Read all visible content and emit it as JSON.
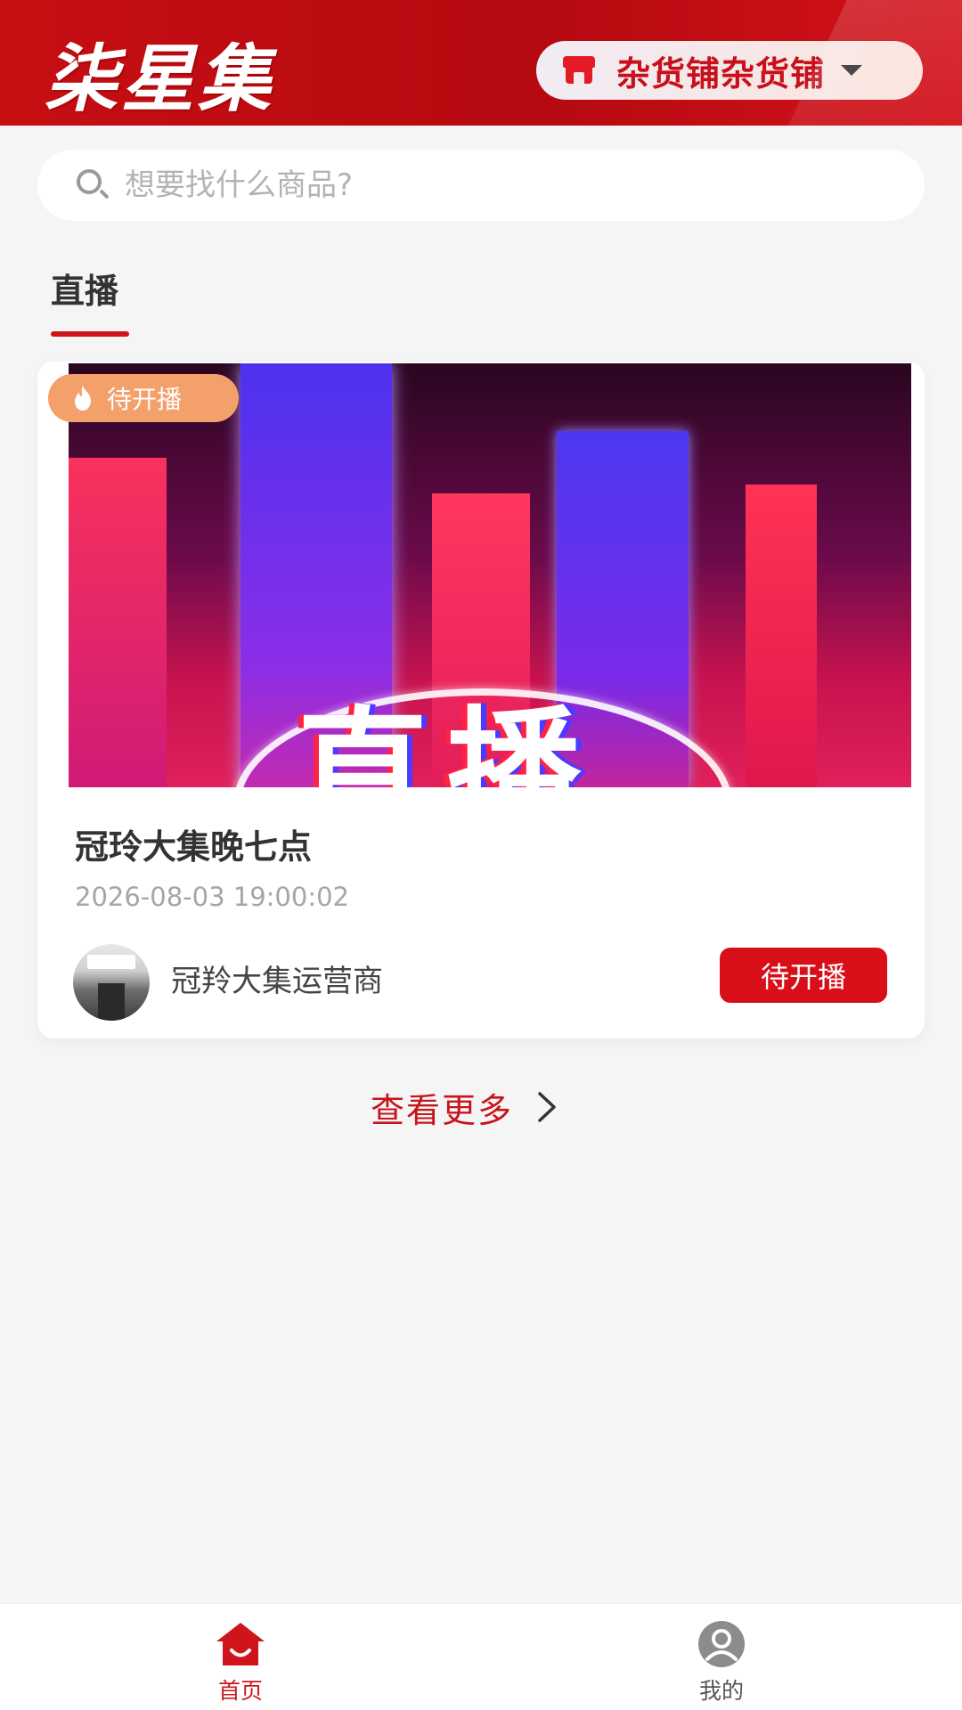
{
  "header": {
    "logo_text": "柒星集",
    "store_selector": {
      "label": "杂货铺杂货铺",
      "icon": "store-icon",
      "dropdown_icon": "caret-down-icon"
    }
  },
  "search": {
    "placeholder": "想要找什么商品?",
    "value": "",
    "icon": "search-icon"
  },
  "section": {
    "title": "直播"
  },
  "live_card": {
    "status_tag": "待开播",
    "status_tag_icon": "flame-icon",
    "cover_text": "直播",
    "title": "冠玲大集晚七点",
    "time": "2026-08-03 19:00:02",
    "host_name": "冠羚大集运营商",
    "status_button": "待开播"
  },
  "view_more": {
    "label": "查看更多",
    "icon": "chevron-right-icon"
  },
  "bottom_nav": {
    "items": [
      {
        "label": "首页",
        "icon": "home-icon",
        "active": true
      },
      {
        "label": "我的",
        "icon": "user-icon",
        "active": false
      }
    ]
  },
  "colors": {
    "brand_red": "#c8101b",
    "tag_orange": "#f3a06a",
    "page_bg": "#f5f5f5"
  }
}
